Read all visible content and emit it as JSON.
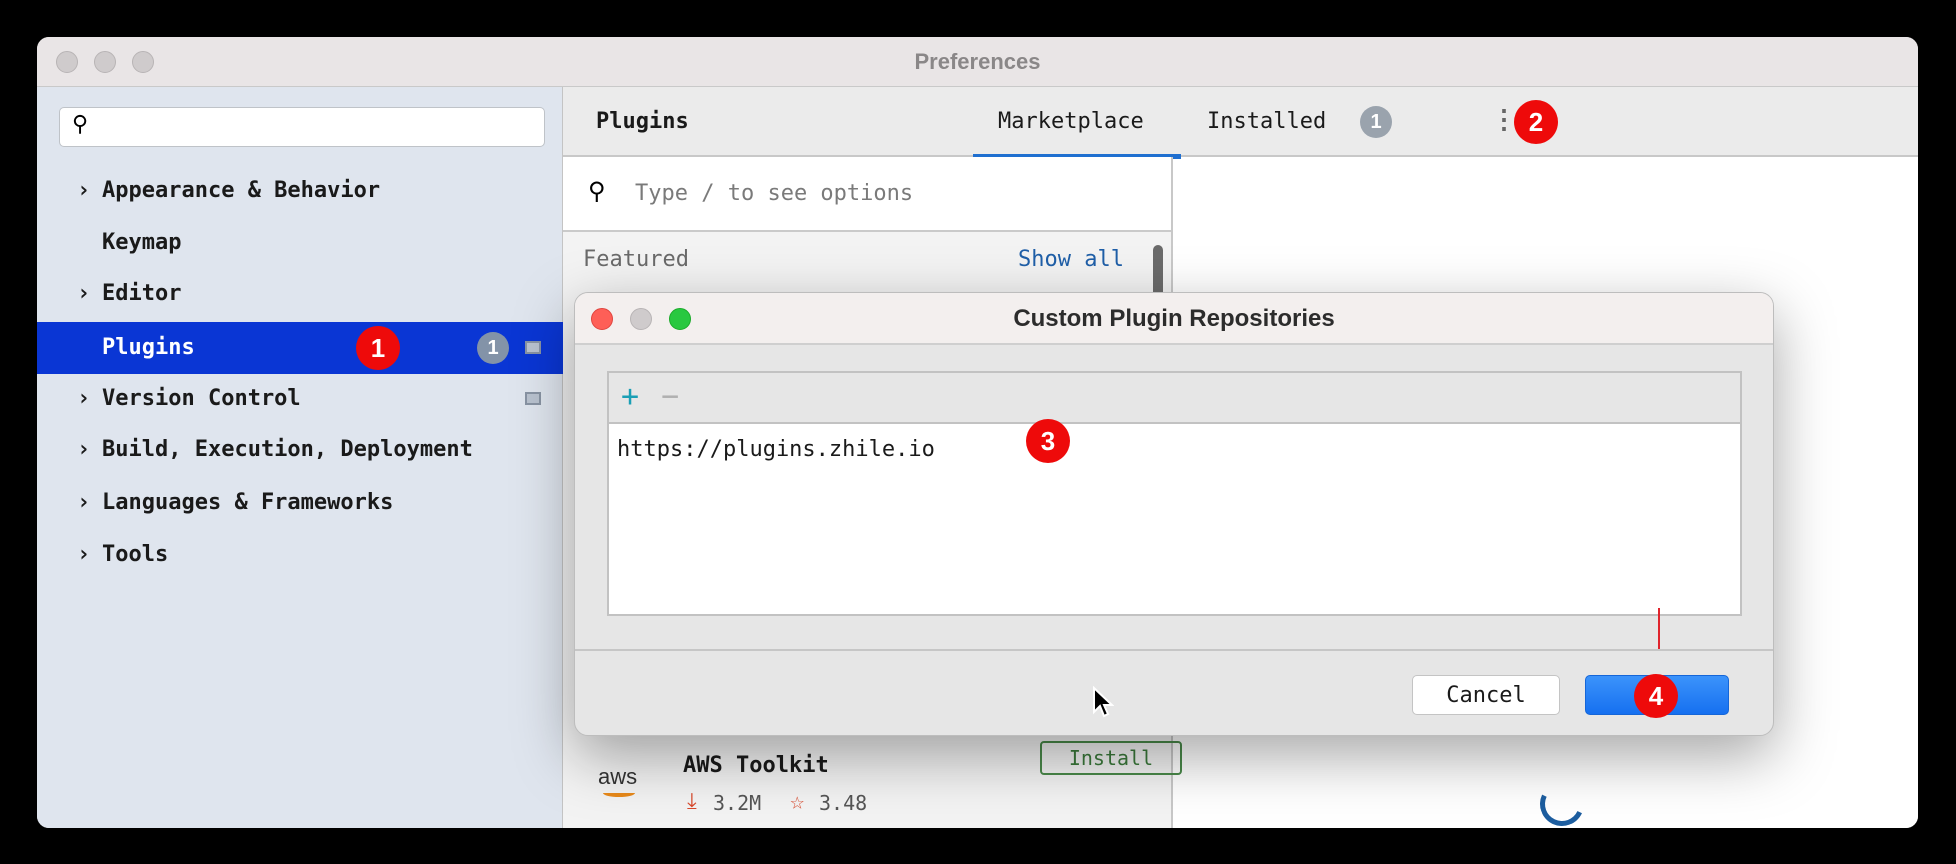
{
  "window": {
    "title": "Preferences"
  },
  "sidebar": {
    "search_placeholder": "",
    "items": [
      {
        "label": "Appearance & Behavior",
        "expandable": true
      },
      {
        "label": "Keymap",
        "expandable": false
      },
      {
        "label": "Editor",
        "expandable": true
      },
      {
        "label": "Plugins",
        "expandable": false,
        "selected": true,
        "count": "1"
      },
      {
        "label": "Version Control",
        "expandable": true
      },
      {
        "label": "Build, Execution, Deployment",
        "expandable": true
      },
      {
        "label": "Languages & Frameworks",
        "expandable": true
      },
      {
        "label": "Tools",
        "expandable": true
      }
    ]
  },
  "main": {
    "title": "Plugins",
    "tabs": [
      {
        "label": "Marketplace",
        "active": true
      },
      {
        "label": "Installed",
        "count": "1"
      }
    ],
    "search_placeholder": "Type / to see options",
    "featured": "Featured",
    "show_all": "Show all",
    "plugin": {
      "name": "AWS Toolkit",
      "logo": "aws",
      "install": "Install",
      "downloads": "3.2M",
      "rating": "3.48"
    }
  },
  "dialog": {
    "title": "Custom Plugin Repositories",
    "add": "+",
    "remove": "−",
    "repositories": [
      "https://plugins.zhile.io"
    ],
    "cancel": "Cancel",
    "ok": ""
  },
  "annotations": [
    "1",
    "2",
    "3",
    "4"
  ],
  "colors": {
    "selection": "#0a36d4",
    "accent": "#1f6fd0",
    "badge": "#ee0a0a",
    "ok": "#1a7cf5"
  }
}
